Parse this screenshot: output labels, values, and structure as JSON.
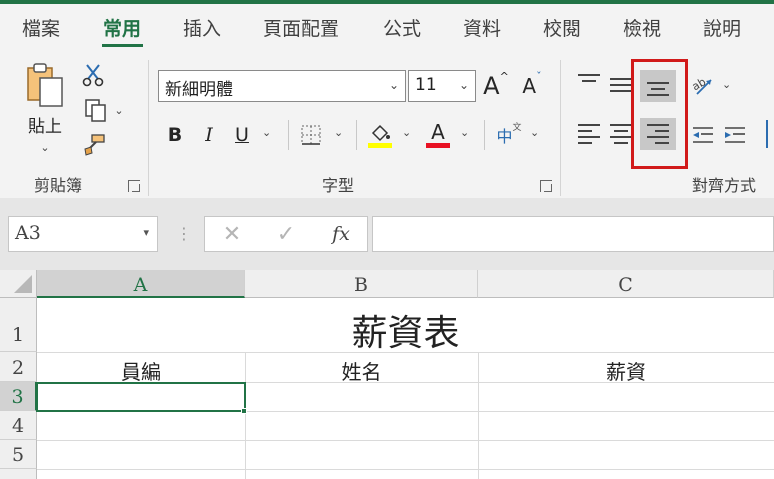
{
  "tabs": [
    "檔案",
    "常用",
    "插入",
    "頁面配置",
    "公式",
    "資料",
    "校閱",
    "檢視",
    "說明"
  ],
  "active_tab": "常用",
  "clipboard": {
    "paste_label": "貼上",
    "group_label": "剪貼簿"
  },
  "font": {
    "name": "新細明體",
    "size": "11",
    "group_label": "字型",
    "bold": "B",
    "italic": "I",
    "underline": "U",
    "grow": "A",
    "shrink": "A",
    "font_color_letter": "A",
    "phonetic": "中"
  },
  "alignment": {
    "group_label": "對齊方式"
  },
  "colors": {
    "accent": "#217346",
    "highlight_yellow": "#ffff00",
    "font_red": "#e81123",
    "annotation_red": "#d11a1a"
  },
  "formula_bar": {
    "name_box": "A3",
    "fx_label": "fx",
    "formula": ""
  },
  "columns": [
    "A",
    "B",
    "C"
  ],
  "rows": [
    "1",
    "2",
    "3",
    "4",
    "5"
  ],
  "cells": {
    "title": "薪資表",
    "a2": "員編",
    "b2": "姓名",
    "c2": "薪資"
  }
}
